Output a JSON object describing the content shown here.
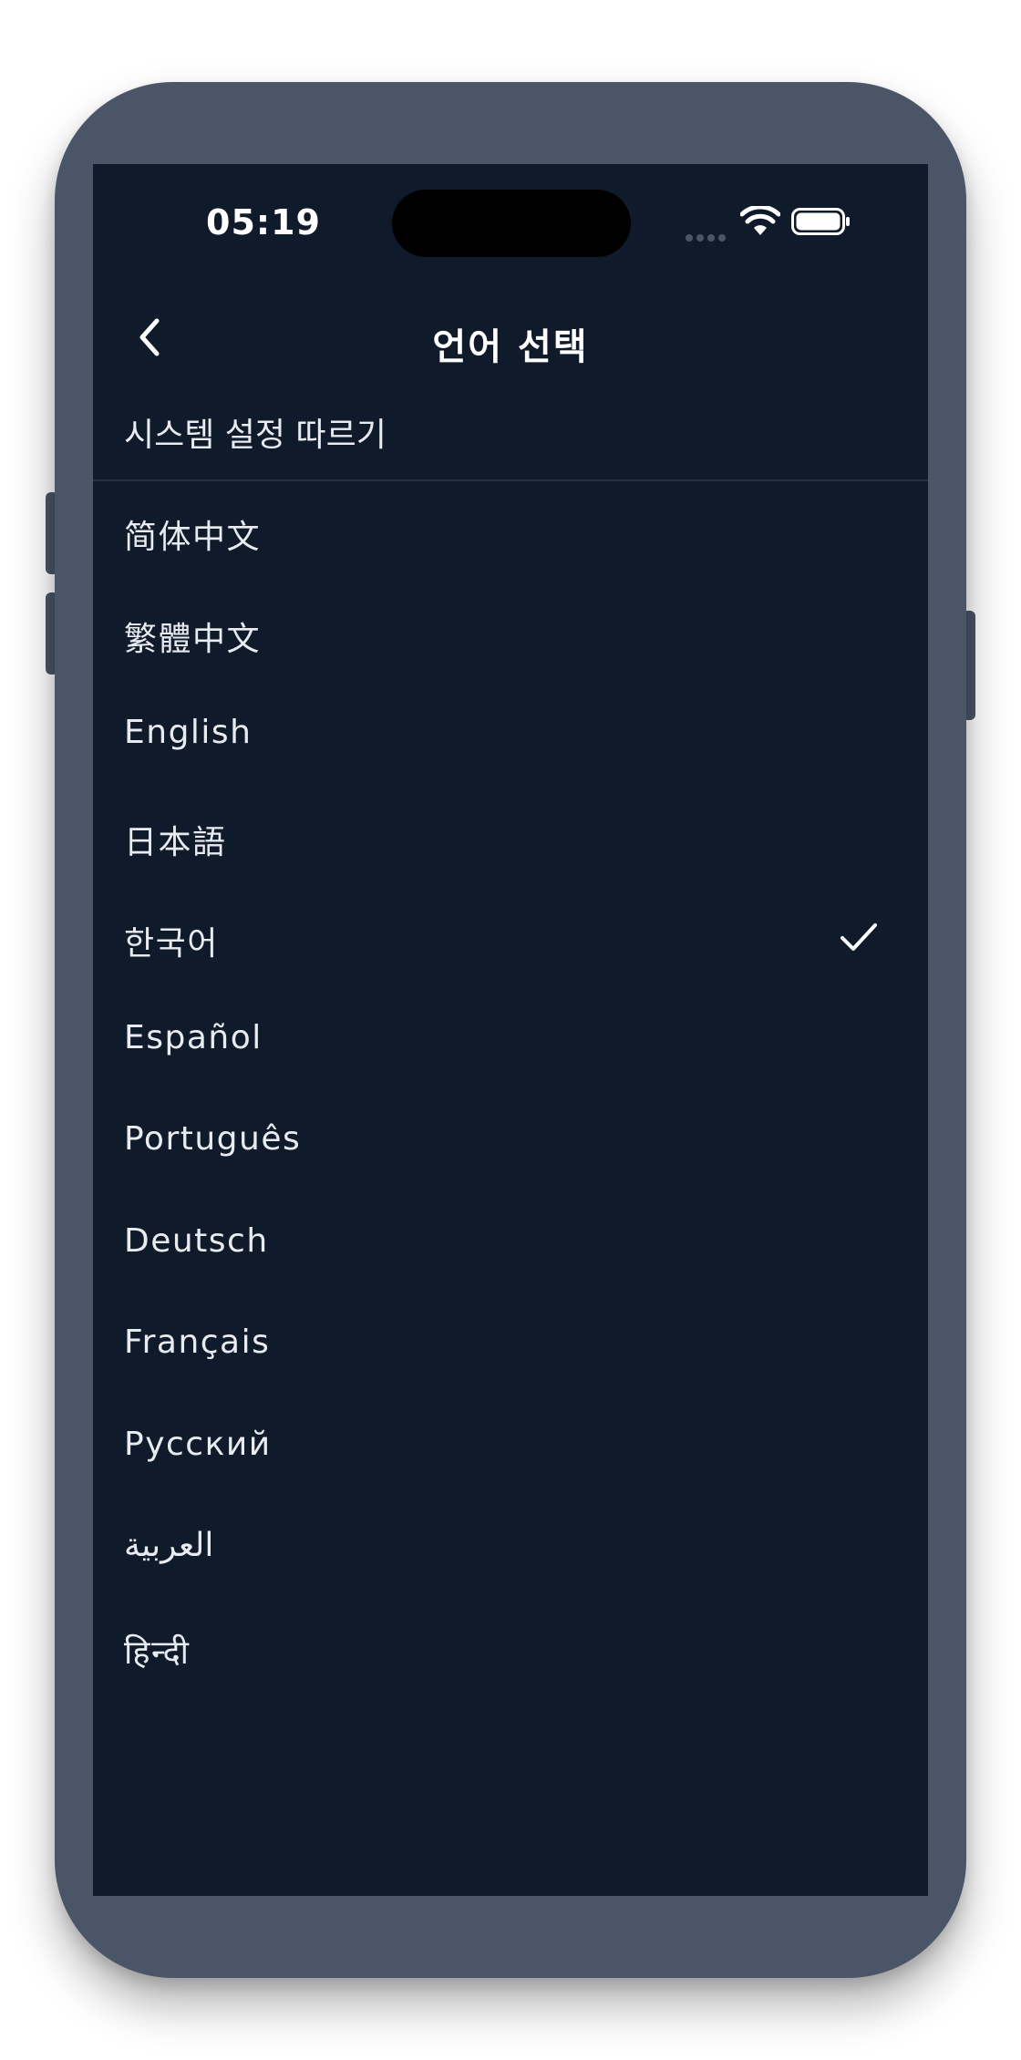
{
  "status_bar": {
    "time": "05:19",
    "icons": [
      "cellular-signal-icon",
      "wifi-icon",
      "battery-icon"
    ]
  },
  "nav": {
    "title": "언어 선택",
    "back_icon": "chevron-left-icon"
  },
  "system_option": {
    "label": "시스템 설정 따르기"
  },
  "languages": [
    {
      "label": "简体中文",
      "selected": false
    },
    {
      "label": "繁體中文",
      "selected": false
    },
    {
      "label": "English",
      "selected": false
    },
    {
      "label": "日本語",
      "selected": false
    },
    {
      "label": "한국어",
      "selected": true
    },
    {
      "label": "Español",
      "selected": false
    },
    {
      "label": "Português",
      "selected": false
    },
    {
      "label": "Deutsch",
      "selected": false
    },
    {
      "label": "Français",
      "selected": false
    },
    {
      "label": "Русский",
      "selected": false
    },
    {
      "label": "العربية",
      "selected": false
    },
    {
      "label": "हिन्दी",
      "selected": false
    }
  ],
  "colors": {
    "background": "#0f1a2a",
    "device_frame": "#4a5568",
    "text": "#e8ebf0",
    "divider": "#26303f"
  }
}
